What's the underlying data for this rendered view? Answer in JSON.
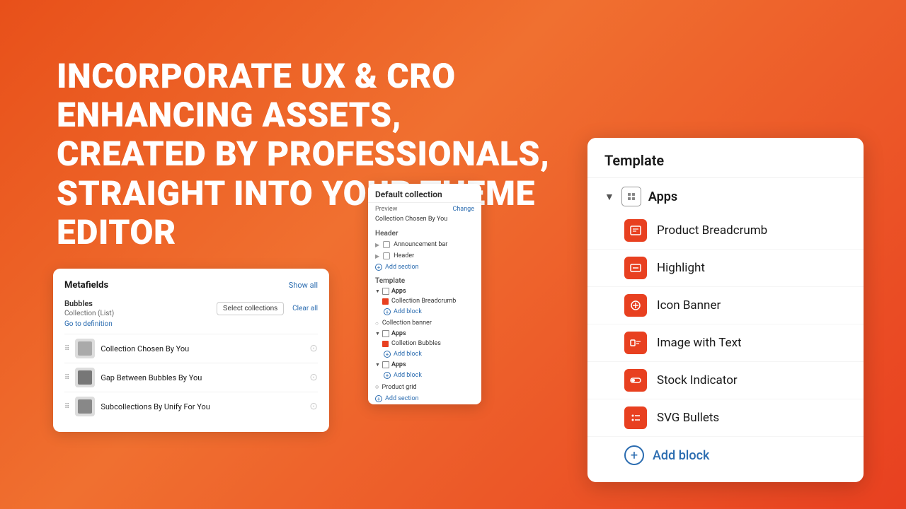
{
  "background": {
    "gradient_start": "#e8501a",
    "gradient_end": "#e84020"
  },
  "headline": {
    "line1": "INCORPORATE UX & CRO ENHANCING ASSETS,",
    "line2": "CREATED BY PROFESSIONALS,",
    "line3": "STRAIGHT INTO YOUR THEME EDITOR"
  },
  "metafields_panel": {
    "title": "Metafields",
    "show_all": "Show all",
    "field_label": "Bubbles",
    "field_type": "Collection (List)",
    "field_link": "Go to definition",
    "select_collections": "Select collections",
    "clear_all": "Clear all",
    "items": [
      {
        "label": "Collection Chosen By You"
      },
      {
        "label": "Gap Between Bubbles By You"
      },
      {
        "label": "Subcollections By Unify For You"
      }
    ]
  },
  "theme_editor_panel": {
    "title": "Default collection",
    "preview_label": "Preview",
    "change_label": "Change",
    "collection_name": "Collection Chosen By You",
    "header_label": "Header",
    "items": [
      {
        "label": "Announcement bar"
      },
      {
        "label": "Header"
      }
    ],
    "add_section_label": "Add section",
    "template_label": "Template",
    "apps_sections": [
      {
        "label": "Apps",
        "blocks": [
          "Collection Breadcrumb"
        ],
        "add_block": "Add block"
      },
      {
        "label": "Collection banner",
        "blocks": []
      },
      {
        "label": "Apps",
        "blocks": [
          "Colletion Bubbles"
        ],
        "add_block": "Add block"
      },
      {
        "label": "Apps",
        "blocks": [],
        "add_block": "Add block"
      }
    ],
    "product_grid": "Product grid",
    "add_section": "Add section"
  },
  "template_panel": {
    "title": "Template",
    "apps_label": "Apps",
    "items": [
      {
        "label": "Product Breadcrumb"
      },
      {
        "label": "Highlight"
      },
      {
        "label": "Icon Banner"
      },
      {
        "label": "Image with Text"
      },
      {
        "label": "Stock Indicator"
      },
      {
        "label": "SVG Bullets"
      }
    ],
    "add_block_label": "Add block"
  }
}
